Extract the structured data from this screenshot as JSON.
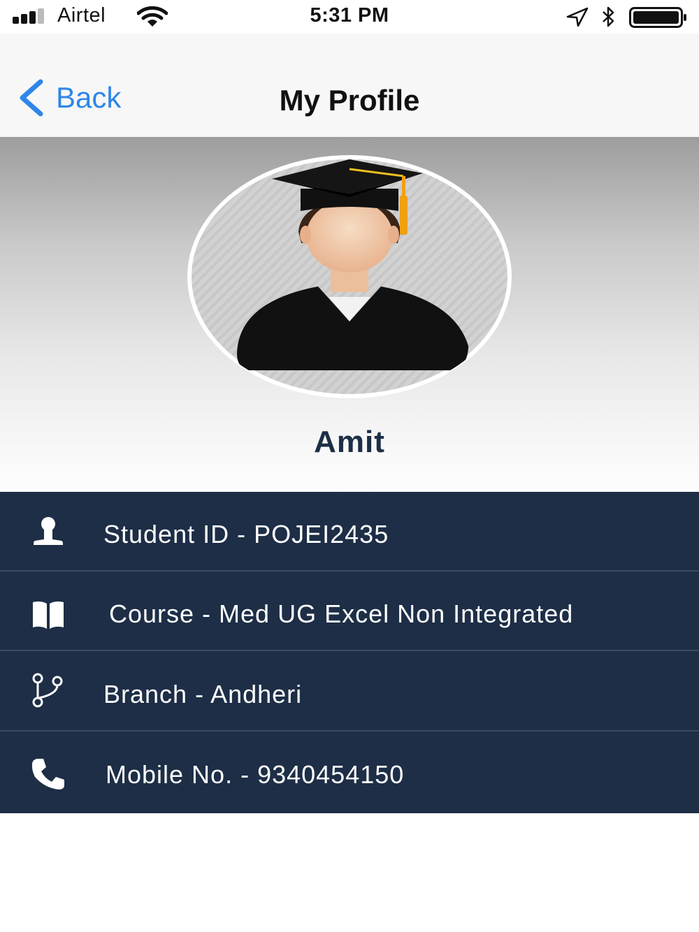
{
  "status_bar": {
    "carrier": "Airtel",
    "time": "5:31 PM",
    "icons": [
      "signal-icon",
      "wifi-icon",
      "location-arrow-icon",
      "bluetooth-icon",
      "battery-icon"
    ]
  },
  "nav": {
    "back_label": "Back",
    "title": "My Profile",
    "accent_color": "#2f86e8"
  },
  "profile": {
    "name": "Amit",
    "avatar_icon": "graduate-avatar-icon"
  },
  "details": {
    "student_id": "Student ID - POJEI2435",
    "course": "Course - Med UG Excel Non Integrated",
    "branch": "Branch - Andheri",
    "mobile": "Mobile No. - 9340454150"
  },
  "colors": {
    "panel": "#1d2e46",
    "divider": "#3a4a60",
    "name_text": "#1d2e46"
  }
}
